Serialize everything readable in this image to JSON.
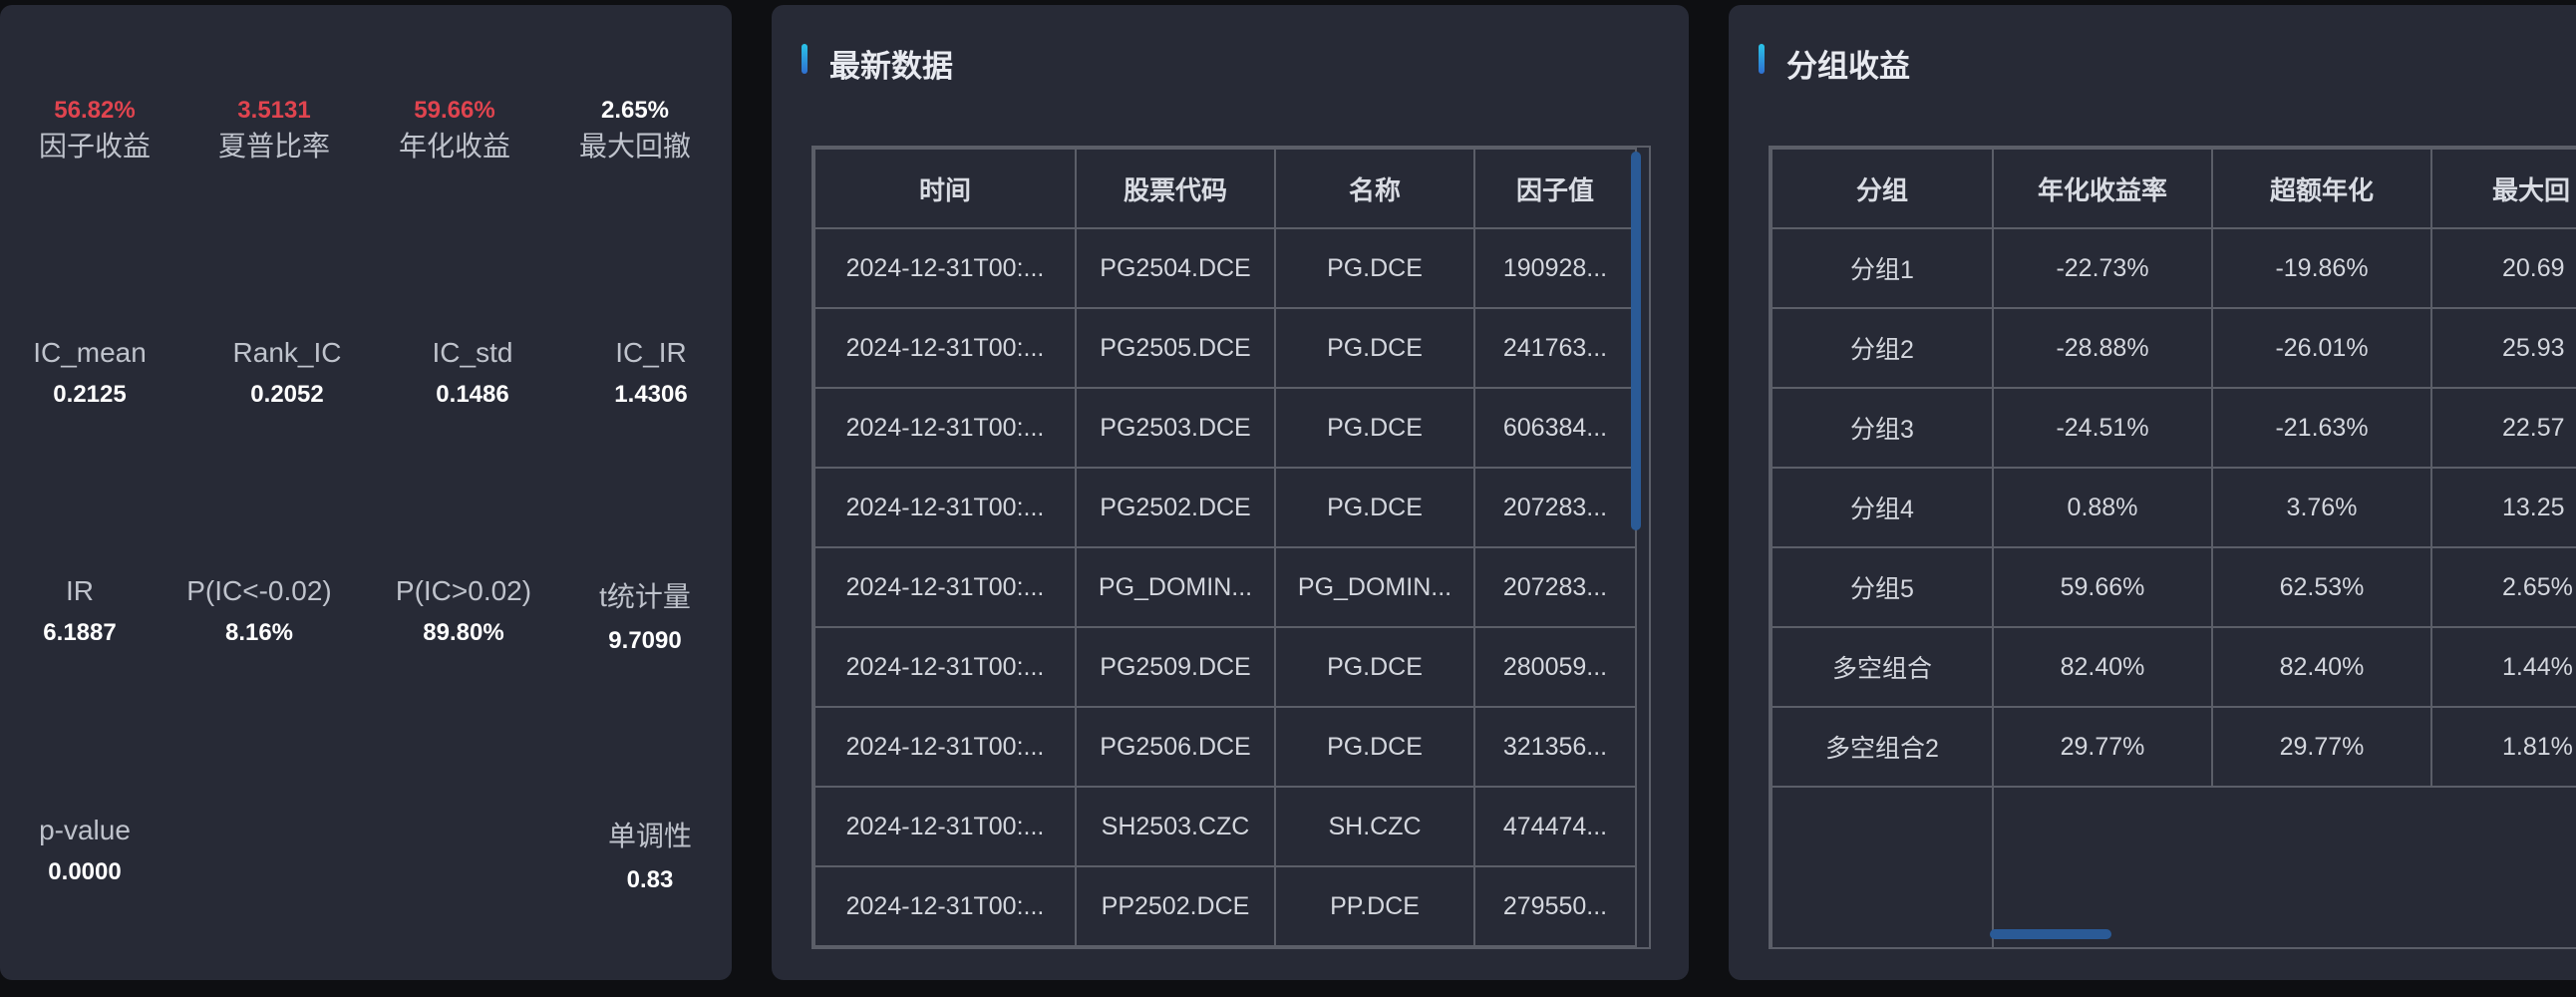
{
  "metrics": {
    "row1": [
      {
        "value": "56.82%",
        "label": "因子收益"
      },
      {
        "value": "3.5131",
        "label": "夏普比率"
      },
      {
        "value": "59.66%",
        "label": "年化收益"
      },
      {
        "value": "2.65%",
        "label": "最大回撤"
      }
    ],
    "row2": [
      {
        "label": "IC_mean",
        "value": "0.2125"
      },
      {
        "label": "Rank_IC",
        "value": "0.2052"
      },
      {
        "label": "IC_std",
        "value": "0.1486"
      },
      {
        "label": "IC_IR",
        "value": "1.4306"
      }
    ],
    "row3": [
      {
        "label": "IR",
        "value": "6.1887"
      },
      {
        "label": "P(IC<-0.02)",
        "value": "8.16%"
      },
      {
        "label": "P(IC>0.02)",
        "value": "89.80%"
      },
      {
        "label": "t统计量",
        "value": "9.7090"
      }
    ],
    "row4": [
      {
        "label": "p-value",
        "value": "0.0000"
      },
      {
        "label": "单调性",
        "value": "0.83"
      }
    ]
  },
  "latest": {
    "title": "最新数据",
    "columns": [
      "时间",
      "股票代码",
      "名称",
      "因子值"
    ],
    "rows": [
      [
        "2024-12-31T00:...",
        "PG2504.DCE",
        "PG.DCE",
        "190928..."
      ],
      [
        "2024-12-31T00:...",
        "PG2505.DCE",
        "PG.DCE",
        "241763..."
      ],
      [
        "2024-12-31T00:...",
        "PG2503.DCE",
        "PG.DCE",
        "606384..."
      ],
      [
        "2024-12-31T00:...",
        "PG2502.DCE",
        "PG.DCE",
        "207283..."
      ],
      [
        "2024-12-31T00:...",
        "PG_DOMIN...",
        "PG_DOMIN...",
        "207283..."
      ],
      [
        "2024-12-31T00:...",
        "PG2509.DCE",
        "PG.DCE",
        "280059..."
      ],
      [
        "2024-12-31T00:...",
        "PG2506.DCE",
        "PG.DCE",
        "321356..."
      ],
      [
        "2024-12-31T00:...",
        "SH2503.CZC",
        "SH.CZC",
        "474474..."
      ],
      [
        "2024-12-31T00:...",
        "PP2502.DCE",
        "PP.DCE",
        "279550..."
      ]
    ]
  },
  "groups": {
    "title": "分组收益",
    "columns": [
      "分组",
      "年化收益率",
      "超额年化",
      "最大回"
    ],
    "rows": [
      [
        "分组1",
        "-22.73%",
        "-19.86%",
        "20.69"
      ],
      [
        "分组2",
        "-28.88%",
        "-26.01%",
        "25.93"
      ],
      [
        "分组3",
        "-24.51%",
        "-21.63%",
        "22.57"
      ],
      [
        "分组4",
        "0.88%",
        "3.76%",
        "13.25"
      ],
      [
        "分组5",
        "59.66%",
        "62.53%",
        "2.65%"
      ],
      [
        "多空组合",
        "82.40%",
        "82.40%",
        "1.44%"
      ],
      [
        "多空组合2",
        "29.77%",
        "29.77%",
        "1.81%"
      ]
    ]
  }
}
